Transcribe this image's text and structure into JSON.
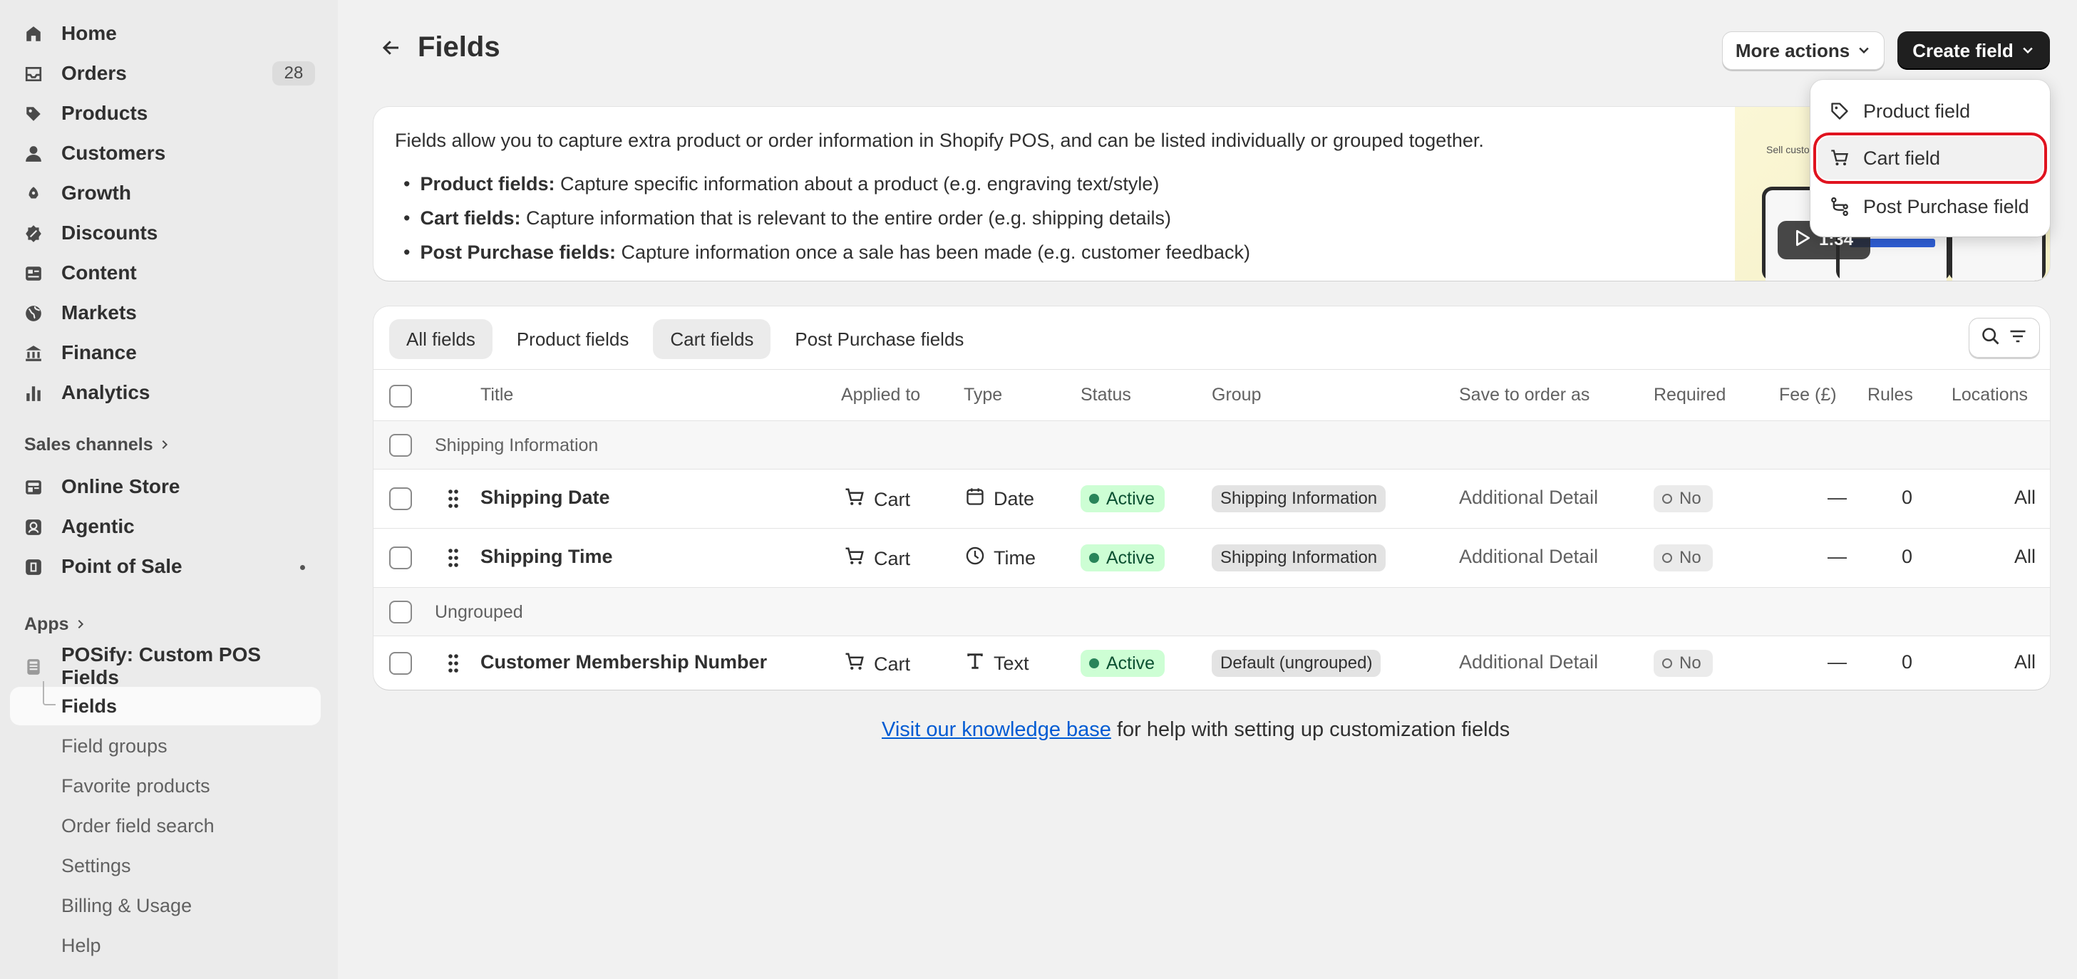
{
  "sidebar": {
    "main_items": [
      {
        "label": "Home",
        "icon": "home-icon"
      },
      {
        "label": "Orders",
        "icon": "inbox-icon",
        "count": "28"
      },
      {
        "label": "Products",
        "icon": "tag-icon"
      },
      {
        "label": "Customers",
        "icon": "person-icon"
      },
      {
        "label": "Growth",
        "icon": "growth-icon"
      },
      {
        "label": "Discounts",
        "icon": "discount-icon"
      },
      {
        "label": "Content",
        "icon": "content-icon"
      },
      {
        "label": "Markets",
        "icon": "globe-icon"
      },
      {
        "label": "Finance",
        "icon": "bank-icon"
      },
      {
        "label": "Analytics",
        "icon": "bar-chart-icon"
      }
    ],
    "sales_channels_label": "Sales channels",
    "channels": [
      {
        "label": "Online Store",
        "icon": "store-icon"
      },
      {
        "label": "Agentic",
        "icon": "agent-icon"
      },
      {
        "label": "Point of Sale",
        "icon": "pos-icon"
      }
    ],
    "apps_label": "Apps",
    "app": {
      "label": "POSify: Custom POS Fields",
      "icon": "app-icon"
    },
    "app_subitems": [
      "Fields",
      "Field groups",
      "Favorite products",
      "Order field search",
      "Settings",
      "Billing & Usage",
      "Help"
    ]
  },
  "header": {
    "title": "Fields",
    "more_actions": "More actions",
    "create_field": "Create field"
  },
  "dropdown": {
    "items": [
      {
        "label": "Product field",
        "icon": "tag-outline-icon"
      },
      {
        "label": "Cart field",
        "icon": "cart-icon"
      },
      {
        "label": "Post Purchase field",
        "icon": "flow-icon"
      }
    ]
  },
  "info": {
    "intro": "Fields allow you to capture extra product or order information in Shopify POS, and can be listed individually or grouped together.",
    "bullets": [
      {
        "term": "Product fields:",
        "text": " Capture specific information about a product (e.g. engraving text/style)"
      },
      {
        "term": "Cart fields:",
        "text": " Capture information that is relevant to the entire order (e.g. shipping details)"
      },
      {
        "term": "Post Purchase fields:",
        "text": " Capture information once a sale has been made (e.g. customer feedback)"
      }
    ],
    "video_duration": "1:34",
    "video_caption": "Sell custom..."
  },
  "tabs": [
    "All fields",
    "Product fields",
    "Cart fields",
    "Post Purchase fields"
  ],
  "table": {
    "headers": {
      "title": "Title",
      "applied_to": "Applied to",
      "type": "Type",
      "status": "Status",
      "group": "Group",
      "save_as": "Save to order as",
      "required": "Required",
      "fee": "Fee (£)",
      "rules": "Rules",
      "locations": "Locations"
    },
    "groups": [
      {
        "name": "Shipping Information",
        "rows": [
          {
            "title": "Shipping Date",
            "applied_to": "Cart",
            "type": "Date",
            "type_icon": "calendar-icon",
            "status": "Active",
            "group": "Shipping Information",
            "save_as": "Additional Detail",
            "required": "No",
            "fee": "—",
            "rules": "0",
            "locations": "All"
          },
          {
            "title": "Shipping Time",
            "applied_to": "Cart",
            "type": "Time",
            "type_icon": "clock-icon",
            "status": "Active",
            "group": "Shipping Information",
            "save_as": "Additional Detail",
            "required": "No",
            "fee": "—",
            "rules": "0",
            "locations": "All"
          }
        ]
      },
      {
        "name": "Ungrouped",
        "rows": [
          {
            "title": "Customer Membership Number",
            "applied_to": "Cart",
            "type": "Text",
            "type_icon": "text-icon",
            "status": "Active",
            "group": "Default (ungrouped)",
            "save_as": "Additional Detail",
            "required": "No",
            "fee": "—",
            "rules": "0",
            "locations": "All"
          }
        ]
      }
    ]
  },
  "footer": {
    "link": "Visit our knowledge base",
    "text": " for help with setting up customization fields"
  },
  "colors": {
    "accent_red": "#e0131f",
    "active_green_bg": "#cdfed4",
    "link_blue": "#005bd3",
    "primary_dark": "#1f1f1f"
  }
}
